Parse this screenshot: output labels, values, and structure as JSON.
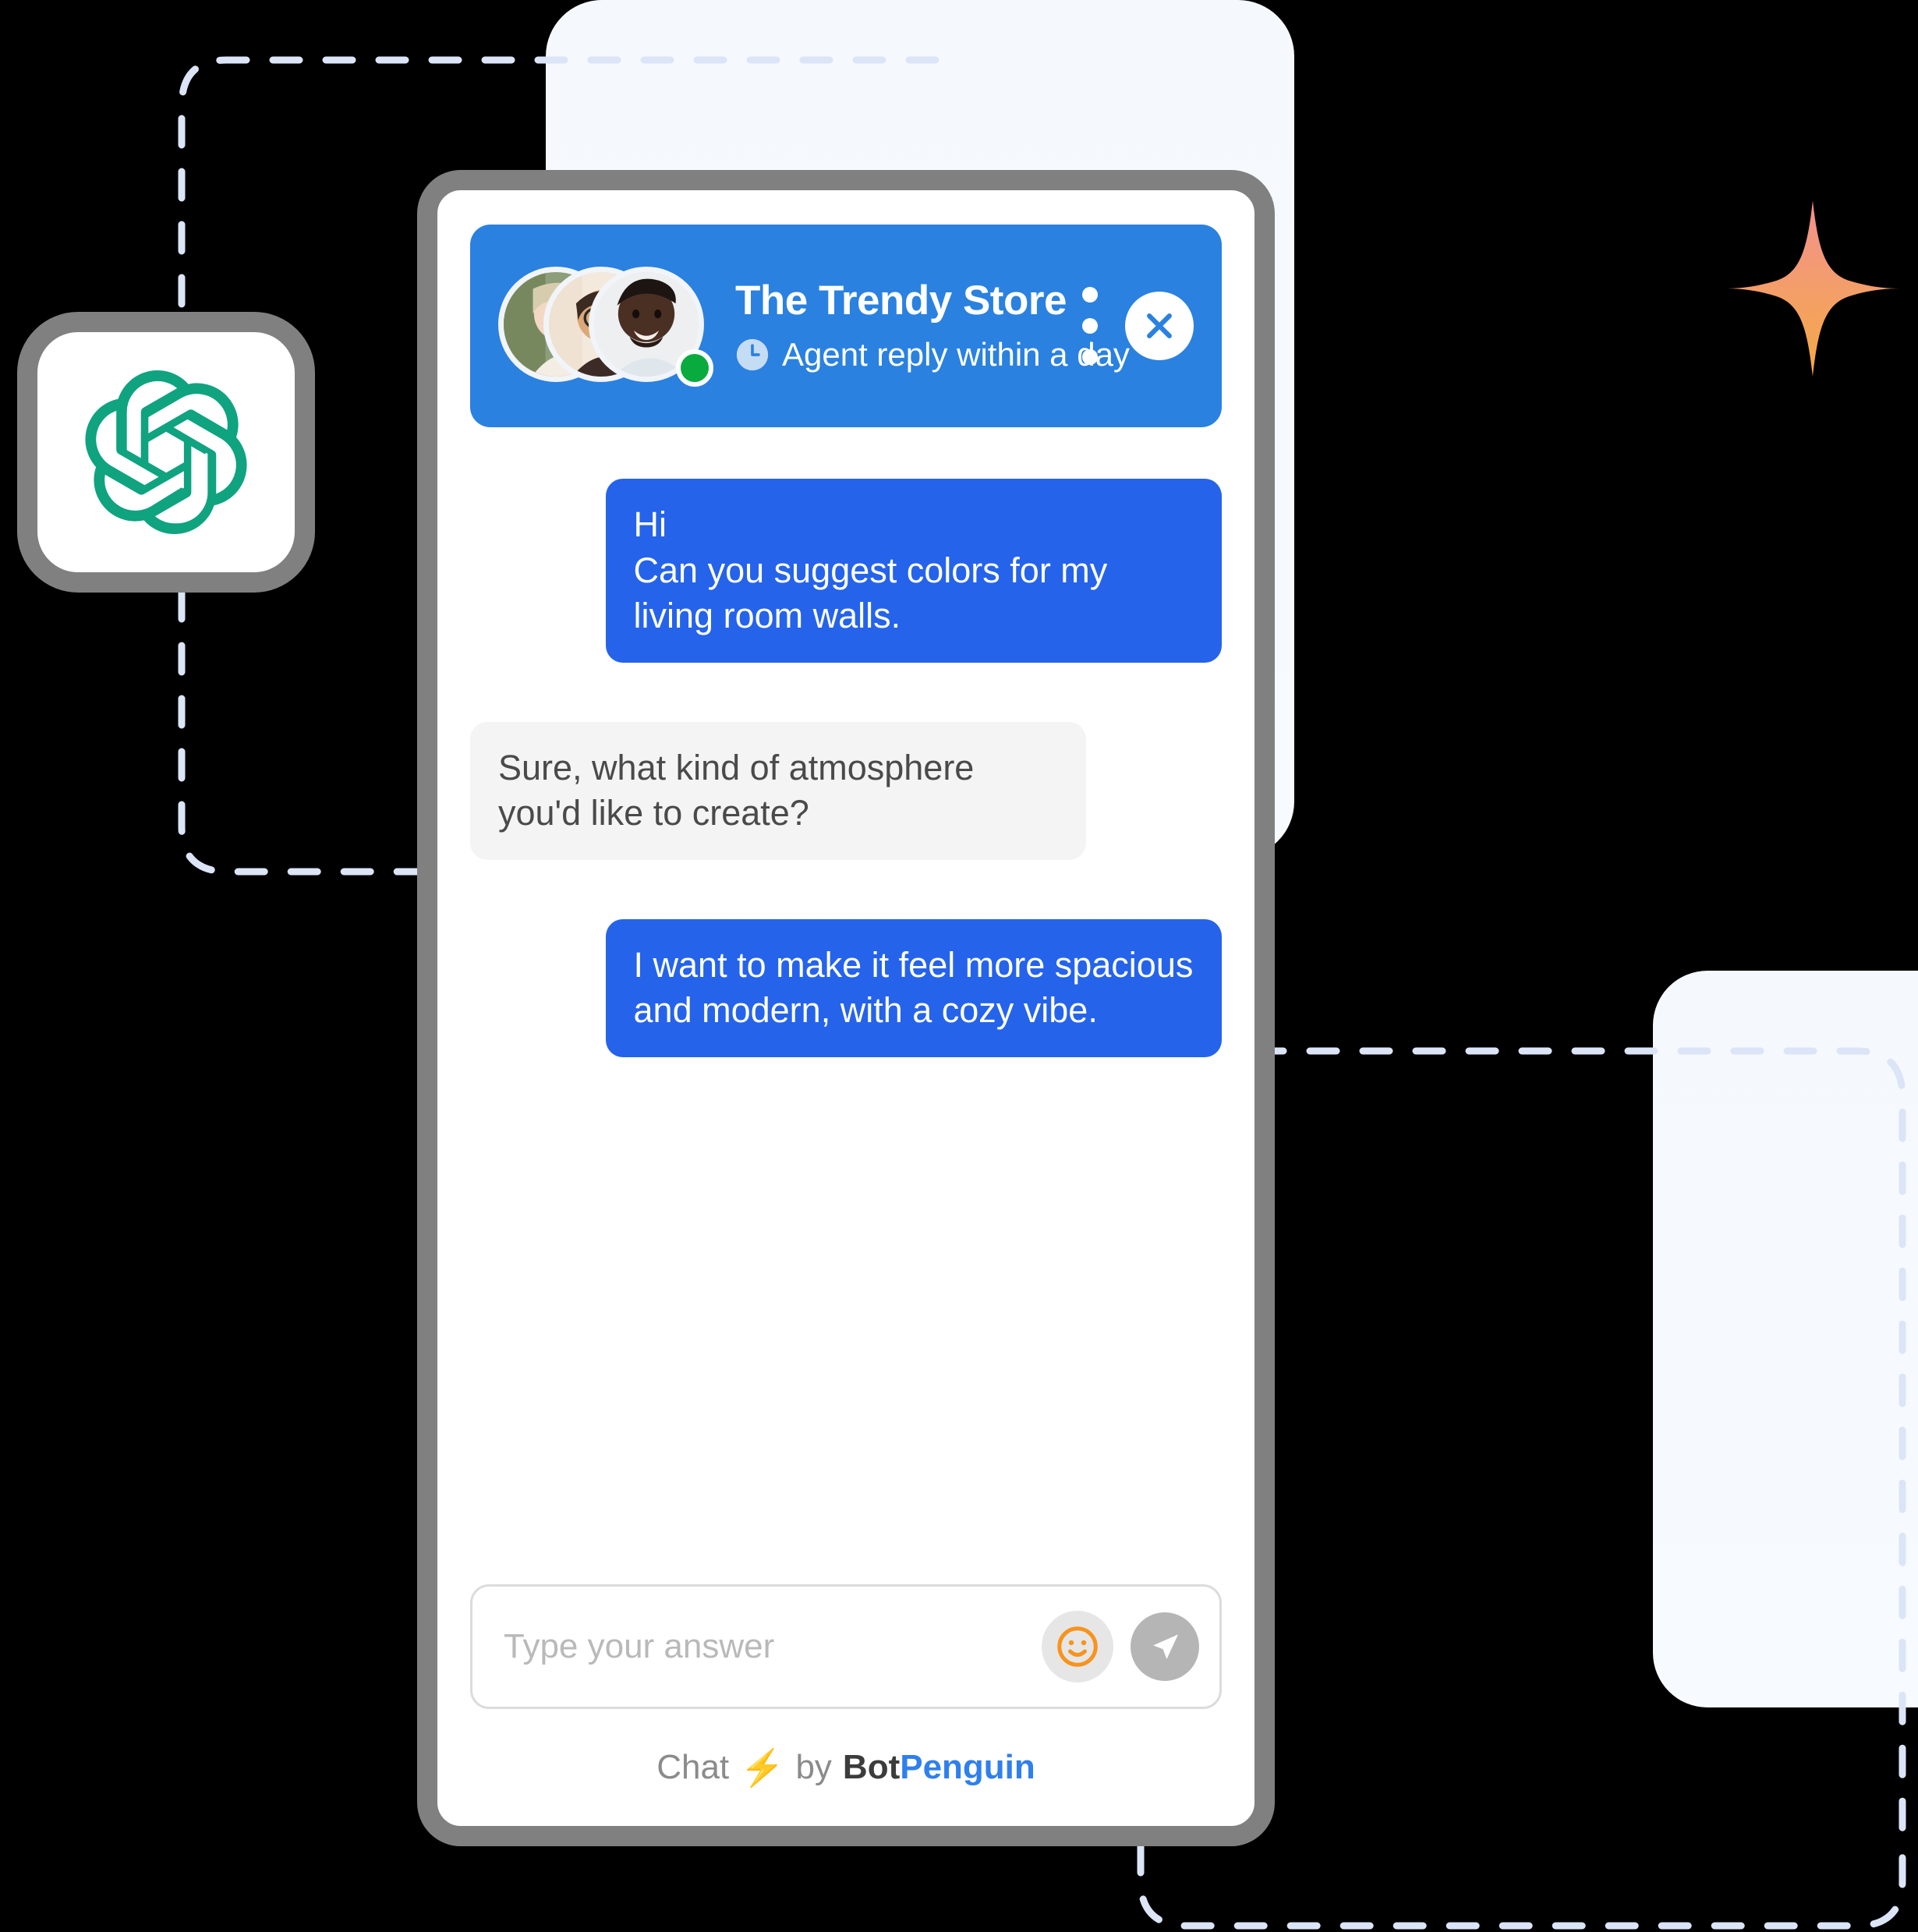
{
  "decor": {
    "openai_logo": "openai-logo-icon",
    "sparkle": "sparkle-icon",
    "dashed_connector": "dashed-connector-line",
    "ghost_panel_top": "background-panel-top",
    "ghost_panel_right": "background-panel-right",
    "colors": {
      "header_blue": "#2a81e0",
      "user_bubble_blue": "#2563eb",
      "bot_bubble_gray": "#f4f4f5",
      "online_green": "#09ab3f",
      "emoji_orange": "#f7941d",
      "brand_blue": "#2f80ed",
      "bolt_yellow": "#fbbe23",
      "openai_green": "#10a37f",
      "window_frame_gray": "#808080",
      "sparkle_gradient_start": "#f2918f",
      "sparkle_gradient_end": "#f5aa45"
    }
  },
  "header": {
    "title": "The Trendy Store",
    "status_text": "Agent reply within a day",
    "clock_icon": "clock-icon",
    "menu_icon": "kebab-menu-icon",
    "close_icon": "close-icon",
    "avatars": [
      {
        "name": "agent-avatar-1"
      },
      {
        "name": "agent-avatar-2"
      },
      {
        "name": "agent-avatar-3"
      }
    ],
    "online_indicator": "online-status-dot"
  },
  "messages": [
    {
      "sender": "user",
      "text": "Hi\nCan you suggest colors for my living room walls."
    },
    {
      "sender": "bot",
      "text": "Sure, what kind of atmosphere you'd like to create?"
    },
    {
      "sender": "user",
      "text": "I want to make it feel more spacious and modern, with a cozy vibe."
    }
  ],
  "composer": {
    "placeholder": "Type your answer",
    "value": "",
    "emoji_icon": "emoji-smiley-icon",
    "send_icon": "send-paper-plane-icon"
  },
  "footer": {
    "chat_label": "Chat",
    "bolt": "⚡",
    "by_label": "by",
    "brand_first": "Bot",
    "brand_second": "Penguin"
  }
}
